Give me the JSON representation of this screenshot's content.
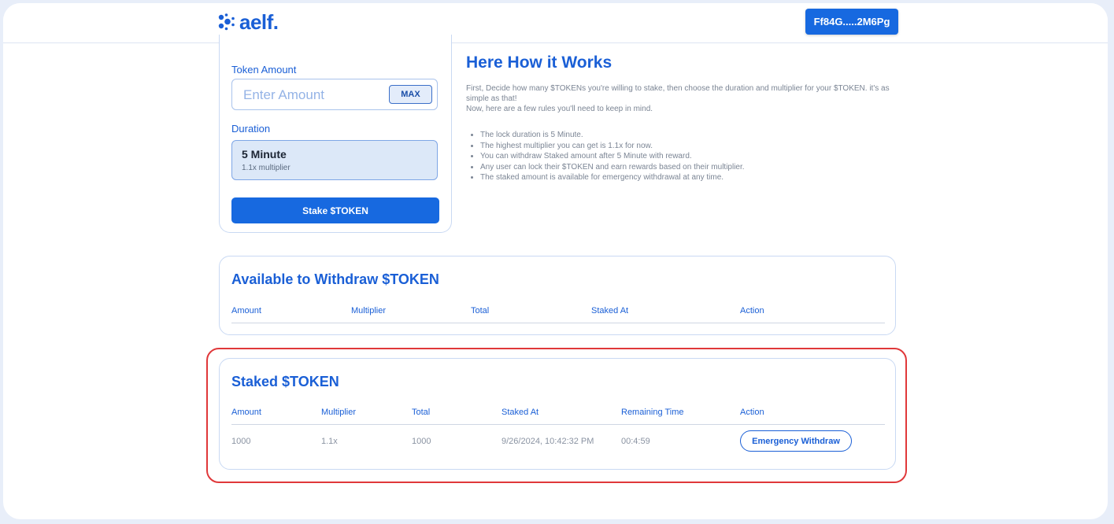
{
  "header": {
    "logo_text": "aelf.",
    "wallet_label": "Ff84G.....2M6Pg"
  },
  "stake_form": {
    "token_amount_label": "Token Amount",
    "amount_placeholder": "Enter Amount",
    "max_label": "MAX",
    "duration_label": "Duration",
    "duration_option": {
      "title": "5 Minute",
      "subtitle": "1.1x multiplier"
    },
    "stake_button": "Stake $TOKEN"
  },
  "how_it_works": {
    "title": "Here How it Works",
    "intro_line1": "First, Decide how many $TOKENs you're willing to stake, then choose the duration and multiplier for your $TOKEN. it's as simple as that!",
    "intro_line2": "Now, here are a few rules you'll need to keep in mind.",
    "rules": [
      "The lock duration is 5 Minute.",
      "The highest multiplier you can get is 1.1x for now.",
      "You can withdraw Staked amount after 5 Minute with reward.",
      "Any user can lock their $TOKEN and earn rewards based on their multiplier.",
      "The staked amount is available for emergency withdrawal at any time."
    ]
  },
  "available": {
    "title": "Available to Withdraw $TOKEN",
    "columns": [
      "Amount",
      "Multiplier",
      "Total",
      "Staked At",
      "Action"
    ]
  },
  "staked": {
    "title": "Staked $TOKEN",
    "columns": [
      "Amount",
      "Multiplier",
      "Total",
      "Staked At",
      "Remaining Time",
      "Action"
    ],
    "rows": [
      {
        "amount": "1000",
        "multiplier": "1.1x",
        "total": "1000",
        "staked_at": "9/26/2024, 10:42:32 PM",
        "remaining": "00:4:59",
        "action": "Emergency Withdraw"
      }
    ]
  },
  "colors": {
    "accent": "#1769e0",
    "heading": "#1a5fd6",
    "highlight_border": "#e0383a"
  }
}
